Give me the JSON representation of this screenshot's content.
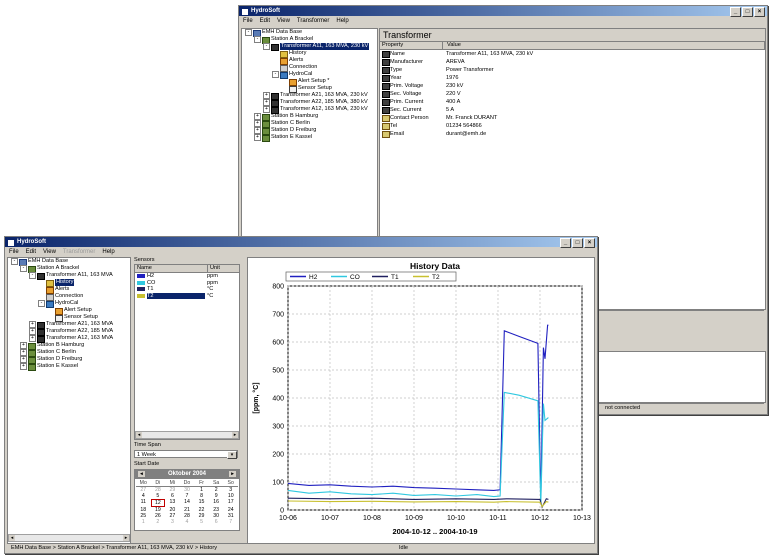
{
  "back_window": {
    "title": "HydroSoft",
    "menu": [
      "File",
      "Edit",
      "View",
      "Transformer",
      "Help"
    ],
    "tree": [
      {
        "label": "EMH Data Base",
        "icon": "database-icon",
        "indent": 0,
        "box": "-"
      },
      {
        "label": "Station A Brackel",
        "icon": "station-icon",
        "indent": 1,
        "box": "-"
      },
      {
        "label": "Transformer A11, 163 MVA, 230 kV",
        "icon": "transformer-icon",
        "indent": 2,
        "box": "-",
        "selected": true
      },
      {
        "label": "History",
        "icon": "history-icon",
        "indent": 3
      },
      {
        "label": "Alerts",
        "icon": "alert-icon",
        "indent": 3
      },
      {
        "label": "Connection",
        "icon": "connection-icon",
        "indent": 3
      },
      {
        "label": "HydroCal",
        "icon": "hydrocal-icon",
        "indent": 3,
        "box": "-"
      },
      {
        "label": "Alert Setup *",
        "icon": "alert-setup-icon",
        "indent": 4
      },
      {
        "label": "Sensor Setup",
        "icon": "sensor-setup-icon",
        "indent": 4
      },
      {
        "label": "Transformer A21, 163 MVA, 230 kV",
        "icon": "transformer-icon",
        "indent": 2,
        "box": "+"
      },
      {
        "label": "Transformer A22, 185 MVA, 380 kV",
        "icon": "transformer-icon",
        "indent": 2,
        "box": "+"
      },
      {
        "label": "Transformer A12, 163 MVA, 230 kV",
        "icon": "transformer-icon",
        "indent": 2,
        "box": "+"
      },
      {
        "label": "Station B Hamburg",
        "icon": "station-icon",
        "indent": 1,
        "box": "+"
      },
      {
        "label": "Station C Berlin",
        "icon": "station-icon",
        "indent": 1,
        "box": "+"
      },
      {
        "label": "Station D Freiburg",
        "icon": "station-icon",
        "indent": 1,
        "box": "+"
      },
      {
        "label": "Station E Kassel",
        "icon": "station-icon",
        "indent": 1,
        "box": "+"
      }
    ],
    "properties_title": "Transformer",
    "properties_headers": {
      "property": "Property",
      "value": "Value"
    },
    "properties": [
      {
        "name": "Name",
        "value": "Transformer A11, 163 MVA, 230 kV",
        "icon": "nameplate"
      },
      {
        "name": "Manufacturer",
        "value": "AREVA",
        "icon": "nameplate"
      },
      {
        "name": "Type",
        "value": "Power Transformer",
        "icon": "nameplate"
      },
      {
        "name": "Year",
        "value": "1976",
        "icon": "nameplate"
      },
      {
        "name": "Prim. Voltage",
        "value": "230 kV",
        "icon": "nameplate"
      },
      {
        "name": "Sec. Voltage",
        "value": "220 V",
        "icon": "nameplate"
      },
      {
        "name": "Prim. Current",
        "value": "400 A",
        "icon": "nameplate"
      },
      {
        "name": "Sec. Current",
        "value": "5 A",
        "icon": "nameplate"
      },
      {
        "name": "Contact Person",
        "value": "Mr. Franck DURANT",
        "icon": "card"
      },
      {
        "name": "Tel",
        "value": "01234 564866",
        "icon": "card"
      },
      {
        "name": "Email",
        "value": "durant@emh.de",
        "icon": "card"
      }
    ],
    "status": "not connected"
  },
  "front_window": {
    "title": "HydroSoft",
    "menu": [
      {
        "label": "File",
        "enabled": true
      },
      {
        "label": "Edit",
        "enabled": true
      },
      {
        "label": "View",
        "enabled": true
      },
      {
        "label": "Transformer",
        "enabled": false
      },
      {
        "label": "Help",
        "enabled": true
      }
    ],
    "tree": [
      {
        "label": "EMH Data Base",
        "icon": "database-icon",
        "indent": 0,
        "box": "-"
      },
      {
        "label": "Station A Brackel",
        "icon": "station-icon",
        "indent": 1,
        "box": "-"
      },
      {
        "label": "Transformer A11, 163 MVA",
        "icon": "transformer-icon",
        "indent": 2,
        "box": "-"
      },
      {
        "label": "History",
        "icon": "history-icon",
        "indent": 3,
        "selected": true
      },
      {
        "label": "Alerts",
        "icon": "alert-icon",
        "indent": 3
      },
      {
        "label": "Connection",
        "icon": "connection-icon",
        "indent": 3
      },
      {
        "label": "HydroCal",
        "icon": "hydrocal-icon",
        "indent": 3,
        "box": "-"
      },
      {
        "label": "Alert Setup",
        "icon": "alert-setup-icon",
        "indent": 4
      },
      {
        "label": "Sensor Setup",
        "icon": "sensor-setup-icon",
        "indent": 4
      },
      {
        "label": "Transformer A21, 163 MVA",
        "icon": "transformer-icon",
        "indent": 2,
        "box": "+"
      },
      {
        "label": "Transformer A22, 185 MVA",
        "icon": "transformer-icon",
        "indent": 2,
        "box": "+"
      },
      {
        "label": "Transformer A12, 163 MVA",
        "icon": "transformer-icon",
        "indent": 2,
        "box": "+"
      },
      {
        "label": "Station B Hamburg",
        "icon": "station-icon",
        "indent": 1,
        "box": "+"
      },
      {
        "label": "Station C Berlin",
        "icon": "station-icon",
        "indent": 1,
        "box": "+"
      },
      {
        "label": "Station D Freiburg",
        "icon": "station-icon",
        "indent": 1,
        "box": "+"
      },
      {
        "label": "Station E Kassel",
        "icon": "station-icon",
        "indent": 1,
        "box": "+"
      }
    ],
    "sensors_label": "Sensors",
    "sensors_headers": {
      "name": "Name",
      "unit": "Unit"
    },
    "sensors": [
      {
        "name": "H2",
        "unit": "ppm",
        "color": "#2020c0"
      },
      {
        "name": "CO",
        "unit": "ppm",
        "color": "#30c8e0"
      },
      {
        "name": "T1",
        "unit": "°C",
        "color": "#202060"
      },
      {
        "name": "T2",
        "unit": "°C",
        "color": "#c8c030",
        "selected": true
      }
    ],
    "time_span_label": "Time Span",
    "time_span_value": "1 Week",
    "start_date_label": "Start Date",
    "calendar": {
      "month_label": "Oktober 2004",
      "day_names": [
        "Mo",
        "Di",
        "Mi",
        "Do",
        "Fr",
        "Sa",
        "So"
      ],
      "weeks": [
        [
          {
            "d": "27",
            "o": true
          },
          {
            "d": "28",
            "o": true
          },
          {
            "d": "29",
            "o": true
          },
          {
            "d": "30",
            "o": true
          },
          {
            "d": "1"
          },
          {
            "d": "2"
          },
          {
            "d": "3"
          }
        ],
        [
          {
            "d": "4"
          },
          {
            "d": "5"
          },
          {
            "d": "6"
          },
          {
            "d": "7"
          },
          {
            "d": "8"
          },
          {
            "d": "9"
          },
          {
            "d": "10"
          }
        ],
        [
          {
            "d": "11"
          },
          {
            "d": "12",
            "today": true
          },
          {
            "d": "13"
          },
          {
            "d": "14"
          },
          {
            "d": "15"
          },
          {
            "d": "16"
          },
          {
            "d": "17"
          }
        ],
        [
          {
            "d": "18"
          },
          {
            "d": "19"
          },
          {
            "d": "20"
          },
          {
            "d": "21"
          },
          {
            "d": "22"
          },
          {
            "d": "23"
          },
          {
            "d": "24"
          }
        ],
        [
          {
            "d": "25"
          },
          {
            "d": "26"
          },
          {
            "d": "27"
          },
          {
            "d": "28"
          },
          {
            "d": "29"
          },
          {
            "d": "30"
          },
          {
            "d": "31"
          }
        ],
        [
          {
            "d": "1",
            "o": true
          },
          {
            "d": "2",
            "o": true
          },
          {
            "d": "3",
            "o": true
          },
          {
            "d": "4",
            "o": true
          },
          {
            "d": "5",
            "o": true
          },
          {
            "d": "6",
            "o": true
          },
          {
            "d": "7",
            "o": true
          }
        ]
      ]
    },
    "status_path": "EMH Data Base > Station A Brackel > Transformer A11, 163 MVA, 230 kV > History",
    "status_state": "Idle"
  },
  "chart_data": {
    "type": "line",
    "title": "History Data",
    "xlabel": "2004-10-12 .. 2004-10-19",
    "ylabel": "[ppm, °C]",
    "ylim": [
      0,
      800
    ],
    "xlim": [
      0,
      7
    ],
    "x_ticks": [
      "10-06",
      "10-07",
      "10-08",
      "10-09",
      "10-10",
      "10-11",
      "10-12",
      "10-13"
    ],
    "y_ticks": [
      0,
      100,
      200,
      300,
      400,
      500,
      600,
      700,
      800
    ],
    "grid": true,
    "legend": "top",
    "series": [
      {
        "name": "H2",
        "color": "#2020c0",
        "points": [
          [
            0,
            95
          ],
          [
            0.5,
            88
          ],
          [
            1,
            90
          ],
          [
            1.5,
            85
          ],
          [
            2,
            82
          ],
          [
            2.5,
            85
          ],
          [
            3,
            80
          ],
          [
            3.5,
            78
          ],
          [
            4,
            75
          ],
          [
            4.5,
            72
          ],
          [
            4.9,
            70
          ],
          [
            5.05,
            72
          ],
          [
            5.15,
            640
          ],
          [
            5.5,
            620
          ],
          [
            5.95,
            595
          ],
          [
            6.02,
            30
          ],
          [
            6.08,
            580
          ],
          [
            6.12,
            540
          ],
          [
            6.18,
            660
          ],
          [
            6.2,
            660
          ]
        ]
      },
      {
        "name": "CO",
        "color": "#30c8e0",
        "points": [
          [
            0,
            70
          ],
          [
            0.5,
            60
          ],
          [
            1,
            65
          ],
          [
            1.5,
            58
          ],
          [
            2,
            55
          ],
          [
            2.5,
            60
          ],
          [
            3,
            52
          ],
          [
            3.5,
            55
          ],
          [
            4,
            50
          ],
          [
            4.5,
            55
          ],
          [
            4.9,
            48
          ],
          [
            5.05,
            50
          ],
          [
            5.15,
            420
          ],
          [
            5.5,
            410
          ],
          [
            5.95,
            390
          ],
          [
            6.02,
            20
          ],
          [
            6.08,
            380
          ],
          [
            6.12,
            320
          ],
          [
            6.2,
            330
          ]
        ]
      },
      {
        "name": "T1",
        "color": "#202060",
        "points": [
          [
            0,
            42
          ],
          [
            1,
            40
          ],
          [
            2,
            42
          ],
          [
            3,
            38
          ],
          [
            4,
            40
          ],
          [
            4.9,
            38
          ],
          [
            5.2,
            40
          ],
          [
            6,
            38
          ],
          [
            6.05,
            10
          ],
          [
            6.15,
            40
          ],
          [
            6.2,
            38
          ]
        ]
      },
      {
        "name": "T2",
        "color": "#c8c030",
        "points": [
          [
            0,
            32
          ],
          [
            1,
            30
          ],
          [
            2,
            31
          ],
          [
            3,
            29
          ],
          [
            4,
            30
          ],
          [
            4.9,
            28
          ],
          [
            5.2,
            30
          ],
          [
            6,
            28
          ],
          [
            6.05,
            12
          ],
          [
            6.15,
            30
          ],
          [
            6.2,
            28
          ]
        ]
      }
    ]
  }
}
